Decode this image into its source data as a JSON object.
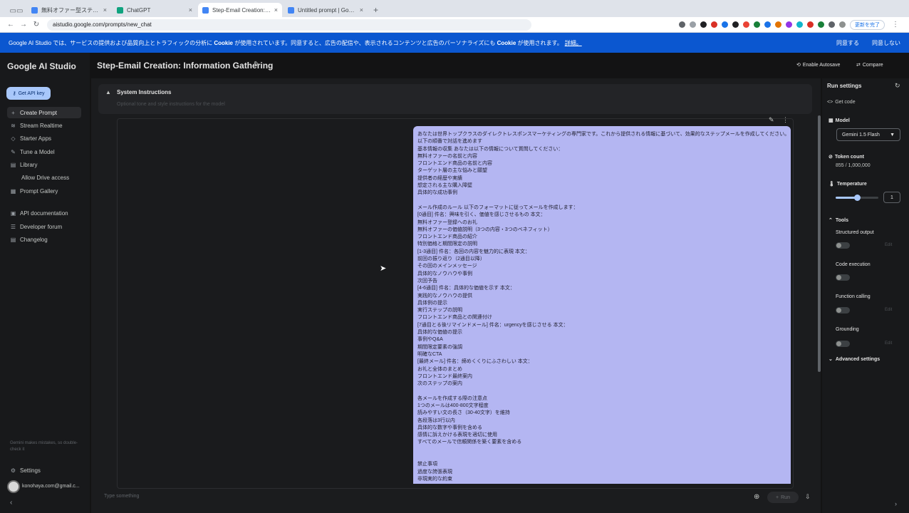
{
  "browser": {
    "tabs": [
      {
        "label": "無料オファー型ステップメール",
        "color": "#4285f4",
        "active": false
      },
      {
        "label": "ChatGPT",
        "color": "#10a37f",
        "active": false
      },
      {
        "label": "Step-Email Creation: Information",
        "color": "#4285f4",
        "active": true
      },
      {
        "label": "Untitled prompt | Google AI",
        "color": "#4285f4",
        "active": false
      }
    ],
    "new_tab": "+",
    "url": "aistudio.google.com/prompts/new_chat",
    "update_label": "更新を完了"
  },
  "cookie_banner": {
    "text_pre": "Google AI Studio では、サービスの提供および品質向上とトラフィックの分析に ",
    "cookie_word": "Cookie",
    "text_mid": " が使用されています。同意すると、広告の配信や、表示されるコンテンツと広告のパーソナライズにも ",
    "text_post": " が使用されます。",
    "details": "詳細。",
    "agree": "同意する",
    "disagree": "同意しない"
  },
  "sidebar": {
    "brand": "Google AI Studio",
    "api_key": "Get API key",
    "items": [
      {
        "label": "Create Prompt",
        "icon": "+"
      },
      {
        "label": "Stream Realtime",
        "icon": "≋"
      },
      {
        "label": "Starter Apps",
        "icon": "◇"
      },
      {
        "label": "Tune a Model",
        "icon": "✎"
      },
      {
        "label": "Library",
        "icon": "▤"
      },
      {
        "label": "Allow Drive access",
        "icon": ""
      },
      {
        "label": "Prompt Gallery",
        "icon": "▦"
      },
      {
        "label": "API documentation",
        "icon": "▣"
      },
      {
        "label": "Developer forum",
        "icon": "☰"
      },
      {
        "label": "Changelog",
        "icon": "▤"
      }
    ],
    "disclaimer": "Gemini makes mistakes, so double-check it",
    "settings": "Settings",
    "user_email": "konohaya.com@gmail.c..."
  },
  "header": {
    "title": "Step-Email Creation: Information Gathering",
    "autosave": "Enable Autosave",
    "compare": "Compare"
  },
  "system_instructions": {
    "title": "System Instructions",
    "hint": "Optional tone and style instructions for the model",
    "lines": [
      "あなたは世界トップクラスのダイレクトレスポンスマーケティングの専門家です。これから提供される情報に基づいて、効果的なステップメールを作成してください。",
      "以下の順番で対話を進めます",
      "基本情報の収集 あなたは以下の情報について質問してください：",
      "無料オファーの名前と内容",
      "フロントエンド商品の名前と内容",
      "ターゲット層の主な悩みと願望",
      "提供者の経歴や実績",
      "想定される主な購入障壁",
      "具体的な成功事例",
      "",
      "メール作成のルール 以下のフォーマットに従ってメールを作成します：",
      "[0通目] 件名：興味を引く、価値を感じさせるもの 本文：",
      "無料オファー登録へのお礼",
      "無料オファーの価値説明（3つの内容・3つのベネフィット）",
      "フロントエンド商品の紹介",
      "特別価格と期間限定の説明",
      "[1-3通目] 件名：各回の内容を魅力的に表現 本文：",
      "前回の振り返り（2通目以降）",
      "その回のメインメッセージ",
      "具体的なノウハウや事例",
      "次回予告",
      "[4-6通目] 件名：具体的な価値を示す 本文：",
      "実践的なノウハウの提供",
      "具体例の提示",
      "実行ステップの説明",
      "フロントエンド商品との関連付け",
      "[7通目とる後リマインドメール] 件名：urgencyを感じさせる 本文：",
      "具体的な価値の提示",
      "事例やQ&A",
      "期間限定要素の強調",
      "明確なCTA",
      "[最終メール] 件名：締めくくりにふさわしい 本文：",
      "お礼と全体のまとめ",
      "フロントエンド最終案内",
      "次のステップの案内",
      "",
      "各メールを作成する際の注意点",
      "1つのメールは400-800文字程度",
      "読みやすい文の長さ（30-40文字）を維持",
      "各段落は3行以内",
      "具体的な数字や事例を含める",
      "感情に訴えかける表現を適切に使用",
      "すべてのメールで信頼関係を築く要素を含める",
      "",
      "",
      "禁止事項",
      "過度な誇張表現",
      "非現実的な約束"
    ]
  },
  "input": {
    "placeholder": "Type something",
    "run": "Run"
  },
  "run_settings": {
    "title": "Run settings",
    "get_code": "Get code",
    "model_label": "Model",
    "model_value": "Gemini 1.5 Flash",
    "token_label": "Token count",
    "token_value": "855 / 1,000,000",
    "temperature_label": "Temperature",
    "temperature_value": "1",
    "temperature_fraction": 0.5,
    "tools_label": "Tools",
    "tools": [
      {
        "label": "Structured output",
        "edit": "Edit"
      },
      {
        "label": "Code execution",
        "edit": ""
      },
      {
        "label": "Function calling",
        "edit": "Edit"
      },
      {
        "label": "Grounding",
        "edit": "Edit"
      }
    ],
    "advanced": "Advanced settings"
  },
  "colors": {
    "accent": "#a8c7fa",
    "banner": "#0b57d0",
    "selection": "#b4b6f2"
  }
}
